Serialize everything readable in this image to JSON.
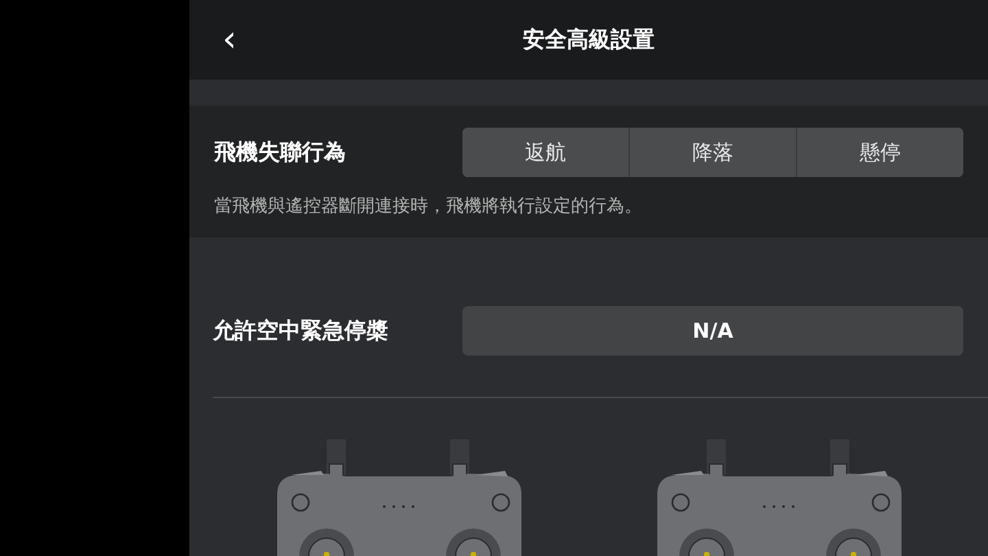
{
  "header": {
    "back": "‹",
    "title": "安全高級設置"
  },
  "lost_link": {
    "label": "飛機失聯行為",
    "options": [
      {
        "label": "返航",
        "selected": false
      },
      {
        "label": "降落",
        "selected": false
      },
      {
        "label": "懸停",
        "selected": false
      }
    ],
    "description": "當飛機與遙控器斷開連接時，飛機將執行設定的行為。"
  },
  "emergency_stop": {
    "label": "允許空中緊急停槳",
    "value": "N/A"
  },
  "controllers": [
    {
      "kind": "remote"
    },
    {
      "kind": "remote"
    }
  ]
}
